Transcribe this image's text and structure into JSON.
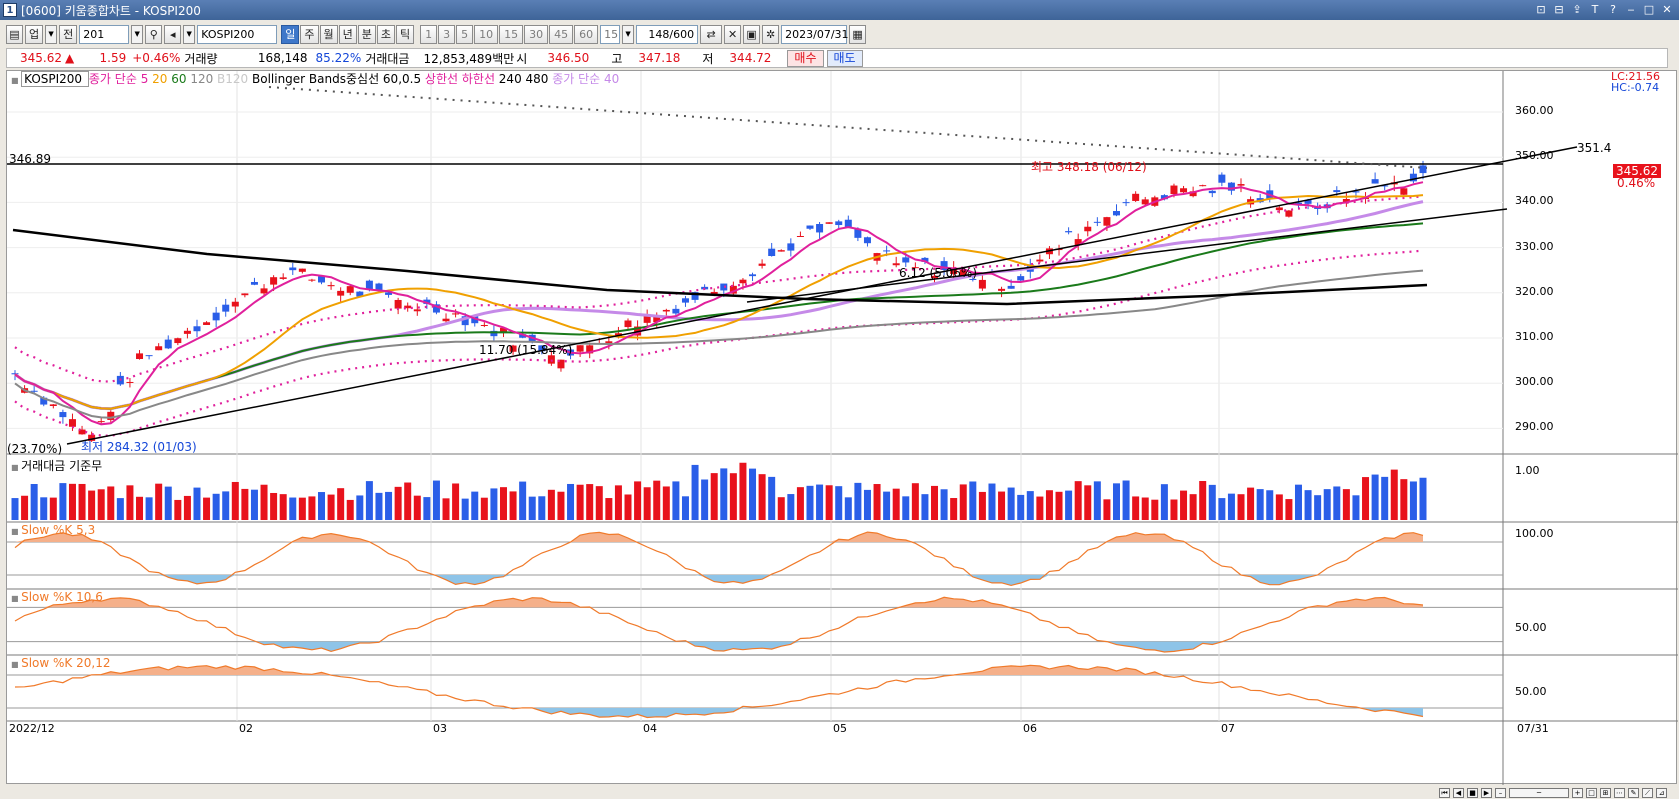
{
  "window": {
    "title": "[0600] 키움종합차트 - KOSPI200",
    "app_icon": "1",
    "controls": [
      "⊡",
      "⊟",
      "⇪",
      "T",
      "?",
      "‒",
      "□",
      "✕"
    ]
  },
  "toolbar": {
    "menu_label": "업",
    "prev_label": "전",
    "code_value": "201",
    "speaker_icon": "speaker-icon",
    "symbol_value": "KOSPI200",
    "periods": [
      "일",
      "주",
      "월",
      "년",
      "분",
      "초",
      "틱"
    ],
    "selected_period": "일",
    "intervals": [
      "1",
      "3",
      "5",
      "10",
      "15",
      "30",
      "45",
      "60"
    ],
    "interval_value": "15",
    "count_value": "148",
    "count_total": "/600",
    "date_value": "2023/07/31"
  },
  "quote": {
    "price": "345.62",
    "arrow": "▲",
    "change": "1.59",
    "change_pct": "+0.46%",
    "volume_label": "거래량",
    "volume": "168,148",
    "volume_ratio": "85.22%",
    "amount_label": "거래대금",
    "amount": "12,853,489백만",
    "open_label": "시",
    "open": "346.50",
    "high_label": "고",
    "high": "347.18",
    "low_label": "저",
    "low": "344.72",
    "buy_label": "매수",
    "sell_label": "매도"
  },
  "legend": {
    "main": [
      {
        "text": "KOSPI200",
        "color": "#000000"
      },
      {
        "text": "종가 단순",
        "color": "#e0209c"
      },
      {
        "text": "5",
        "color": "#e0209c"
      },
      {
        "text": "20",
        "color": "#f0a000"
      },
      {
        "text": "60",
        "color": "#1a7a1a"
      },
      {
        "text": "120",
        "color": "#888888"
      },
      {
        "text": "B120",
        "color": "#c8c8c8"
      },
      {
        "text": "Bollinger Bands중심선 60,0.5",
        "color": "#000000"
      },
      {
        "text": "상한선",
        "color": "#e0209c"
      },
      {
        "text": "하한선",
        "color": "#e0209c"
      },
      {
        "text": "240",
        "color": "#000000"
      },
      {
        "text": "480",
        "color": "#000000"
      },
      {
        "text": "종가 단순 40",
        "color": "#c58ae8"
      }
    ],
    "lc_hc": [
      "LC:21.56",
      "HC:-0.74"
    ],
    "amount_panel": "거래대금 기준무",
    "stoch1": "Slow %K 5,3",
    "stoch2": "Slow %K 10,6",
    "stoch3": "Slow %K 20,12"
  },
  "annotations": {
    "hline_label": "346.89",
    "trend_label": "351.4",
    "high_label": "최고 348.18 (06/12)",
    "low_label": "최저 284.32 (01/03)",
    "low_pct": "(23.70%)",
    "mid1": "11.70 (15.84%)",
    "mid2": "6.12 (5.06%)",
    "last_price_tag": "345.62",
    "last_pct_tag": "0.46%"
  },
  "axes": {
    "price_ticks": [
      "360.00",
      "350.00",
      "340.00",
      "330.00",
      "320.00",
      "310.00",
      "300.00",
      "290.00"
    ],
    "amount_tick": "1.00",
    "stoch1_tick": "100.00",
    "stoch2_tick": "50.00",
    "stoch3_tick": "50.00",
    "x_labels": [
      "2022/12",
      "02",
      "03",
      "04",
      "05",
      "06",
      "07",
      "07/31"
    ]
  },
  "colors": {
    "up": "#e8121c",
    "down": "#2a5ee8",
    "ma5": "#e0209c",
    "ma20": "#f0a000",
    "ma60": "#1a7a1a",
    "ma120": "#888888",
    "b120": "#c8c8c8",
    "ma40": "#c58ae8",
    "stoch": "#f07a2a",
    "stoch_fill": "#f5b08a",
    "stoch_low_fill": "#8ec4e8"
  },
  "icons": {
    "search": "search-icon",
    "calendar": "calendar-icon",
    "settings": "gear-icon",
    "save": "save-icon"
  }
}
